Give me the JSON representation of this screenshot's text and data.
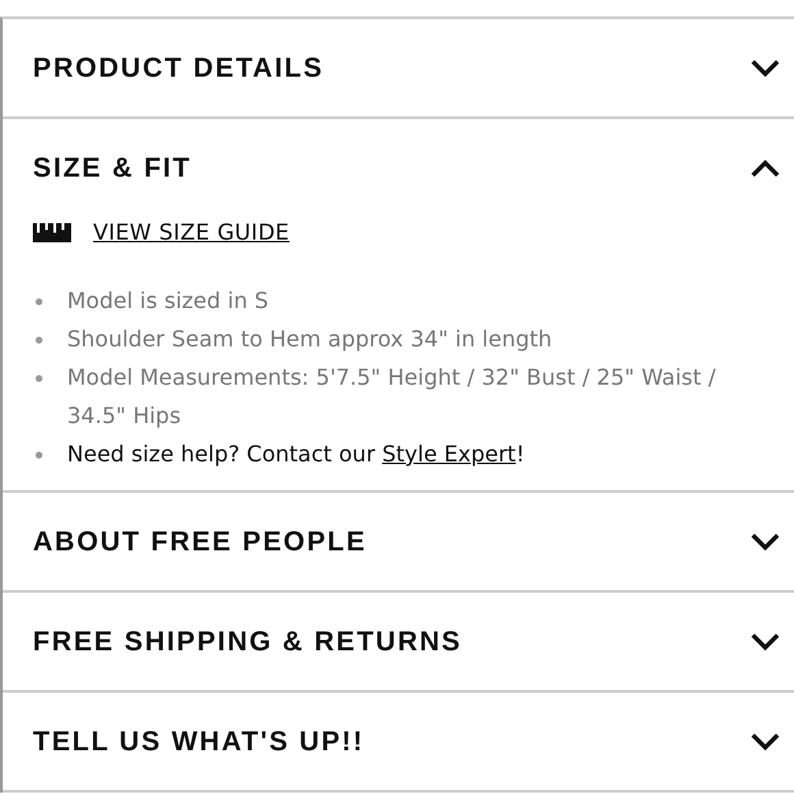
{
  "sections": [
    {
      "title": "PRODUCT DETAILS",
      "expanded": false
    },
    {
      "title": "SIZE & FIT",
      "expanded": true,
      "size_guide_link": "VIEW SIZE GUIDE",
      "bullets": [
        {
          "kind": "note",
          "text": "Model is sized in S"
        },
        {
          "kind": "note",
          "text": "Shoulder Seam to Hem approx 34\" in length"
        },
        {
          "kind": "note",
          "text": "Model Measurements: 5'7.5\" Height / 32\" Bust / 25\" Waist / 34.5\" Hips"
        },
        {
          "kind": "help",
          "text": "Need size help? Contact our ",
          "link": "Style Expert",
          "after": "!"
        }
      ]
    },
    {
      "title": "ABOUT FREE PEOPLE",
      "expanded": false
    },
    {
      "title": "FREE SHIPPING & RETURNS",
      "expanded": false
    },
    {
      "title": "TELL US WHAT'S UP!!",
      "expanded": false
    }
  ]
}
